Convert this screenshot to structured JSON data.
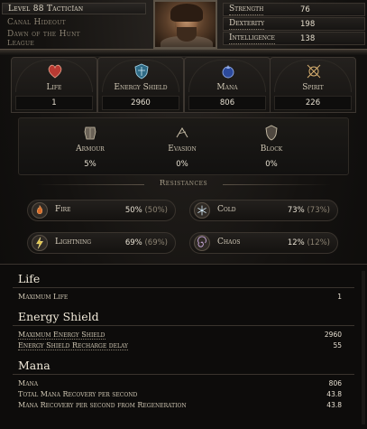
{
  "header": {
    "level_class": "Level 88 Tacticīan",
    "area": "Canal Hideout",
    "league_line1": "Dawn of the Hunt",
    "league_line2": "League"
  },
  "attributes": [
    {
      "name": "Strength",
      "value": "76"
    },
    {
      "name": "Dexterity",
      "value": "198"
    },
    {
      "name": "Intelligence",
      "value": "138"
    }
  ],
  "resources": [
    {
      "label": "Life",
      "value": "1",
      "icon": "heart-icon",
      "color": "#b83a32"
    },
    {
      "label": "Energy Shield",
      "value": "2960",
      "icon": "energy-shield-icon",
      "color": "#6aa9c7"
    },
    {
      "label": "Mana",
      "value": "806",
      "icon": "mana-icon",
      "color": "#4a6bc4"
    },
    {
      "label": "Spirit",
      "value": "226",
      "icon": "spirit-icon",
      "color": "#d8b070"
    }
  ],
  "defences": [
    {
      "label": "Armour",
      "value": "5%",
      "icon": "armour-icon"
    },
    {
      "label": "Evasion",
      "value": "0%",
      "icon": "evasion-icon"
    },
    {
      "label": "Block",
      "value": "0%",
      "icon": "block-icon"
    }
  ],
  "resistances_title": "Resistances",
  "resistances": [
    {
      "name": "Fire",
      "value": "50%",
      "cap": "(50%)",
      "icon": "fire-icon",
      "color": "#d86b2a"
    },
    {
      "name": "Cold",
      "value": "73%",
      "cap": "(73%)",
      "icon": "cold-icon",
      "color": "#9fc2d8"
    },
    {
      "name": "Lightning",
      "value": "69%",
      "cap": "(69%)",
      "icon": "lightning-icon",
      "color": "#e3c64a"
    },
    {
      "name": "Chaos",
      "value": "12%",
      "cap": "(12%)",
      "icon": "chaos-icon",
      "color": "#b07ad0"
    }
  ],
  "details": {
    "life": {
      "title": "Life",
      "rows": [
        {
          "label": "Maximum Life",
          "value": "1"
        }
      ]
    },
    "energy_shield": {
      "title": "Energy Shield",
      "rows": [
        {
          "label": "Maximum Energy Shield",
          "value": "2960"
        },
        {
          "label": "Energy Shield Recharge delay",
          "value": "55"
        }
      ]
    },
    "mana": {
      "title": "Mana",
      "rows": [
        {
          "label": "Mana",
          "value": "806"
        },
        {
          "label": "Total Mana Recovery per second",
          "value": "43.8"
        },
        {
          "label": "Mana Recovery per second from Regeneration",
          "value": "43.8"
        }
      ]
    }
  }
}
